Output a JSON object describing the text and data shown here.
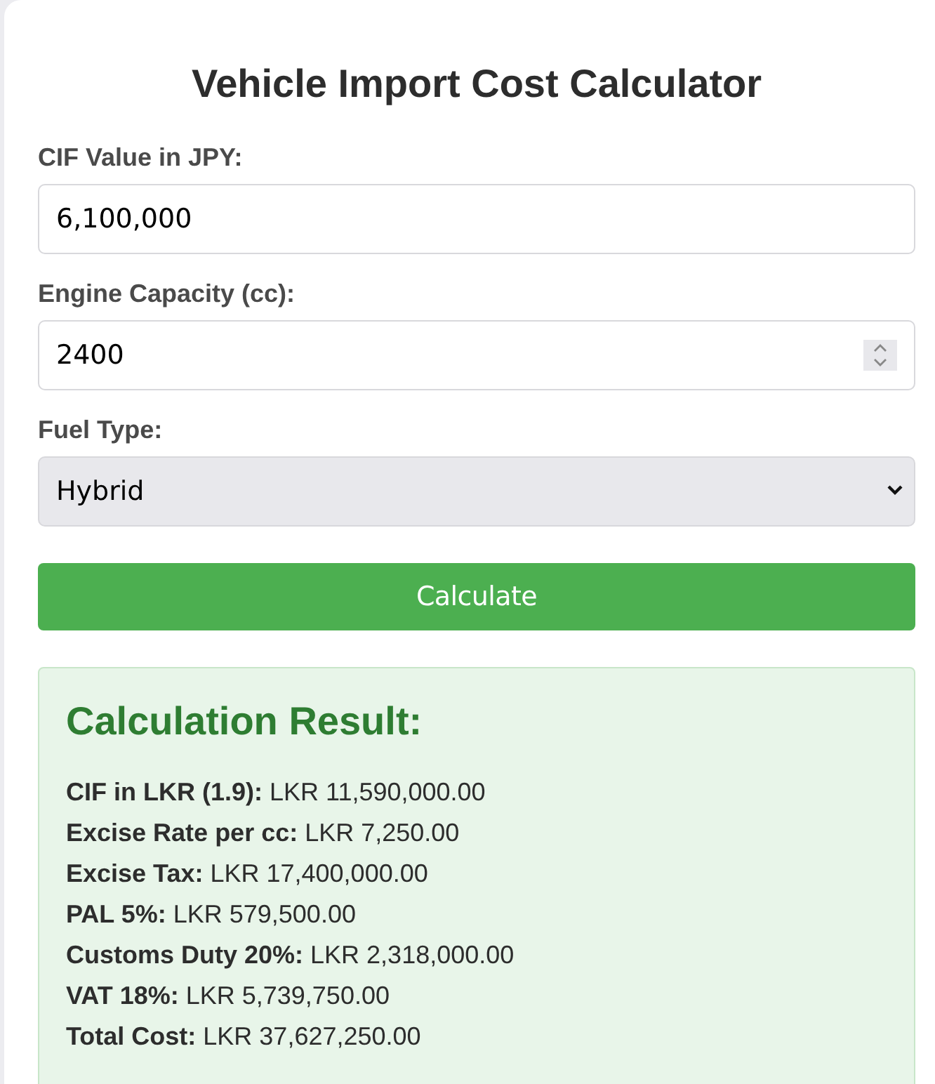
{
  "title": "Vehicle Import Cost Calculator",
  "fields": [
    {
      "kind": "text",
      "label": "CIF Value in JPY:",
      "value": "6,100,000"
    },
    {
      "kind": "number",
      "label": "Engine Capacity (cc):",
      "value": "2400"
    },
    {
      "kind": "select",
      "label": "Fuel Type:",
      "value": "Hybrid"
    }
  ],
  "button": "Calculate",
  "result": {
    "heading": "Calculation Result:",
    "lines": [
      "**CIF in LKR (1.9):** LKR 11,590,000.00",
      "**Excise Rate per cc:** LKR 7,250.00",
      "**Excise Tax:** LKR 17,400,000.00",
      "**PAL 5%:** LKR 579,500.00",
      "**Customs Duty 20%:** LKR 2,318,000.00",
      "**VAT 18%:** LKR 5,739,750.00",
      "**Total Cost:** LKR 37,627,250.00"
    ]
  }
}
